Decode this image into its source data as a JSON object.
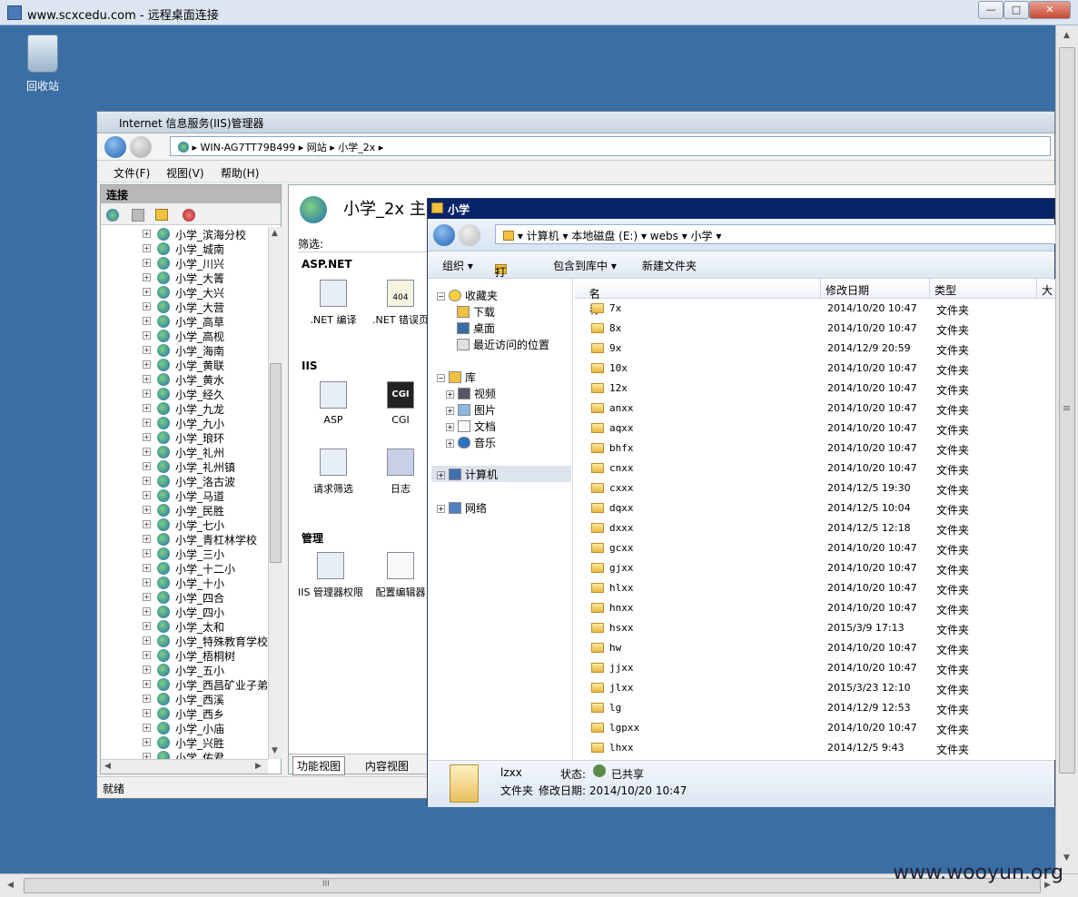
{
  "rdp": {
    "title": "www.scxcedu.com - 远程桌面连接",
    "minimize": "—",
    "maximize": "□",
    "close": "✕"
  },
  "desktop": {
    "recycle_label": "回收站"
  },
  "iis": {
    "title": "Internet 信息服务(IIS)管理器",
    "breadcrumb": [
      "WIN-AG7TT79B499",
      "网站",
      "小学_2x"
    ],
    "menu": [
      "文件(F)",
      "视图(V)",
      "帮助(H)"
    ],
    "connections_header": "连接",
    "tree": [
      "小学_滨海分校",
      "小学_城南",
      "小学_川兴",
      "小学_大箐",
      "小学_大兴",
      "小学_大营",
      "小学_高草",
      "小学_高枧",
      "小学_海南",
      "小学_黄联",
      "小学_黄水",
      "小学_经久",
      "小学_九龙",
      "小学_九小",
      "小学_琅环",
      "小学_礼州",
      "小学_礼州镇",
      "小学_洛古波",
      "小学_马道",
      "小学_民胜",
      "小学_七小",
      "小学_青杠林学校",
      "小学_三小",
      "小学_十二小",
      "小学_十小",
      "小学_四合",
      "小学_四小",
      "小学_太和",
      "小学_特殊教育学校",
      "小学_梧桐树",
      "小学_五小",
      "小学_西昌矿业子弟",
      "小学_西溪",
      "小学_西乡",
      "小学_小庙",
      "小学_兴胜",
      "小学_佑君"
    ],
    "main_heading": "小学_2x 主",
    "filter_label": "筛选:",
    "groups": {
      "aspnet": "ASP.NET",
      "iis": "IIS",
      "manage": "管理"
    },
    "features": {
      "net_compile": ".NET 编译",
      "net_error": ".NET 错误页",
      "asp": "ASP",
      "cgi": "CGI",
      "req_filter": "请求筛选",
      "log": "日志",
      "iis_perm": "IIS 管理器权限",
      "config_editor": "配置编辑器"
    },
    "cgi_icon_text": "CGI",
    "err_icon_text": "404",
    "view_feature": "功能视图",
    "view_content": "内容视图",
    "status": "就绪"
  },
  "explorer": {
    "title": "小学",
    "breadcrumb": [
      "计算机",
      "本地磁盘 (E:)",
      "webs",
      "小学"
    ],
    "commands": [
      "组织 ▾",
      "打开",
      "包含到库中 ▾",
      "新建文件夹"
    ],
    "nav": {
      "favorites": "收藏夹",
      "downloads": "下载",
      "desktop": "桌面",
      "recent": "最近访问的位置",
      "libraries": "库",
      "videos": "视频",
      "pictures": "图片",
      "documents": "文档",
      "music": "音乐",
      "computer": "计算机",
      "network": "网络"
    },
    "columns": [
      "名称",
      "修改日期",
      "类型",
      "大"
    ],
    "files": [
      {
        "name": "7x",
        "date": "2014/10/20 10:47",
        "type": "文件夹"
      },
      {
        "name": "8x",
        "date": "2014/10/20 10:47",
        "type": "文件夹"
      },
      {
        "name": "9x",
        "date": "2014/12/9 20:59",
        "type": "文件夹"
      },
      {
        "name": "10x",
        "date": "2014/10/20 10:47",
        "type": "文件夹"
      },
      {
        "name": "12x",
        "date": "2014/10/20 10:47",
        "type": "文件夹"
      },
      {
        "name": "anxx",
        "date": "2014/10/20 10:47",
        "type": "文件夹"
      },
      {
        "name": "aqxx",
        "date": "2014/10/20 10:47",
        "type": "文件夹"
      },
      {
        "name": "bhfx",
        "date": "2014/10/20 10:47",
        "type": "文件夹"
      },
      {
        "name": "cnxx",
        "date": "2014/10/20 10:47",
        "type": "文件夹"
      },
      {
        "name": "cxxx",
        "date": "2014/12/5 19:30",
        "type": "文件夹"
      },
      {
        "name": "dqxx",
        "date": "2014/12/5 10:04",
        "type": "文件夹"
      },
      {
        "name": "dxxx",
        "date": "2014/12/5 12:18",
        "type": "文件夹"
      },
      {
        "name": "gcxx",
        "date": "2014/10/20 10:47",
        "type": "文件夹"
      },
      {
        "name": "gjxx",
        "date": "2014/10/20 10:47",
        "type": "文件夹"
      },
      {
        "name": "hlxx",
        "date": "2014/10/20 10:47",
        "type": "文件夹"
      },
      {
        "name": "hnxx",
        "date": "2014/10/20 10:47",
        "type": "文件夹"
      },
      {
        "name": "hsxx",
        "date": "2015/3/9 17:13",
        "type": "文件夹"
      },
      {
        "name": "hw",
        "date": "2014/10/20 10:47",
        "type": "文件夹"
      },
      {
        "name": "jjxx",
        "date": "2014/10/20 10:47",
        "type": "文件夹"
      },
      {
        "name": "jlxx",
        "date": "2015/3/23 12:10",
        "type": "文件夹"
      },
      {
        "name": "lg",
        "date": "2014/12/9 12:53",
        "type": "文件夹"
      },
      {
        "name": "lgpxx",
        "date": "2014/10/20 10:47",
        "type": "文件夹"
      },
      {
        "name": "lhxx",
        "date": "2014/12/5 9:43",
        "type": "文件夹"
      }
    ],
    "details": {
      "name": "lzxx",
      "status_label": "状态:",
      "status_value": "已共享",
      "kind": "文件夹",
      "modified": "修改日期: 2014/10/20 10:47"
    }
  },
  "hscroll_grip": "III",
  "vscroll_grip": "≡",
  "watermark": "www.wooyun.org"
}
